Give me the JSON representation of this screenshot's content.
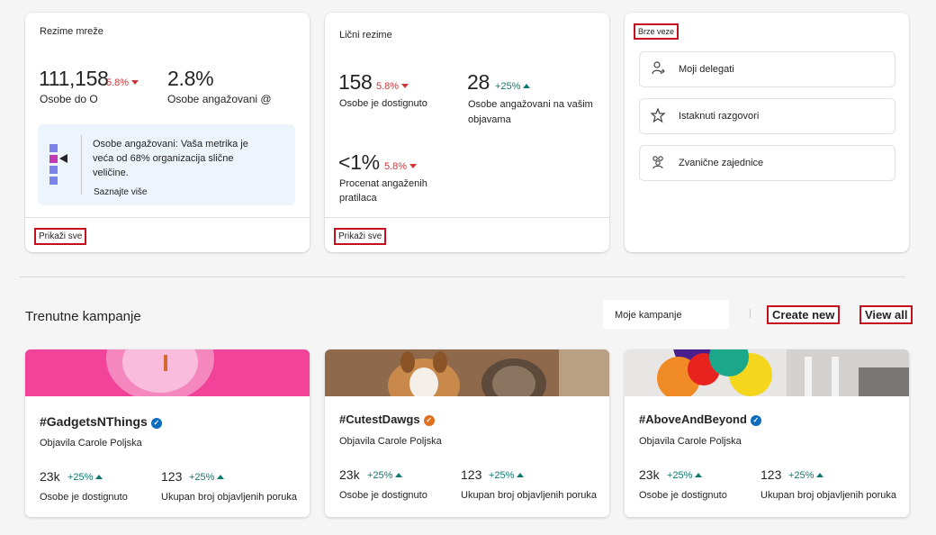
{
  "network": {
    "title": "Rezime mreže",
    "people_value": "111,158",
    "people_delta": "5.8%",
    "people_label": "Osobe do O",
    "engaged_value": "2.8%",
    "engaged_label": "Osobe angažovani @",
    "info_text": "Osobe angažovani: Vaša metrika je veća od 68% organizacija slične veličine.",
    "info_link": "Saznajte više",
    "show_all": "Prikaži sve"
  },
  "personal": {
    "title": "Lični rezime",
    "reached_value": "158",
    "reached_delta": "5.8%",
    "reached_label": "Osobe je dostignuto",
    "engaged_value": "28",
    "engaged_delta": "+25%",
    "engaged_label": "Osobe angažovani na vašim objavama",
    "followers_value": "<1%",
    "followers_delta": "5.8%",
    "followers_label": "Procenat angaženih pratilaca",
    "show_all": "Prikaži sve"
  },
  "quick_links": {
    "title": "Brze veze",
    "items": [
      {
        "label": "Moji delegati",
        "icon": "delegates-icon"
      },
      {
        "label": "Istaknuti razgovori",
        "icon": "star-icon"
      },
      {
        "label": "Zvanične zajednice",
        "icon": "community-icon"
      }
    ]
  },
  "campaigns": {
    "title": "Trenutne kampanje",
    "filter_value": "Moje kampanje",
    "create_new": "Create new",
    "view_all": "View all",
    "items": [
      {
        "name": "#GadgetsNThings",
        "verified_color": "#0f6cbd",
        "by": "Objavila Carole Poljska",
        "reached": "23k",
        "reached_delta": "+25%",
        "reached_label": "Osobe je dostignuto",
        "posts": "123",
        "posts_delta": "+25%",
        "posts_label": "Ukupan broj objavljenih poruka"
      },
      {
        "name": "#CutestDawgs",
        "verified_color": "#e0701f",
        "by": "Objavila Carole Poljska",
        "reached": "23k",
        "reached_delta": "+25%",
        "reached_label": "Osobe je dostignuto",
        "posts": "123",
        "posts_delta": "+25%",
        "posts_label": "Ukupan broj objavljenih poruka"
      },
      {
        "name": "#AboveAndBeyond",
        "verified_color": "#0f6cbd",
        "by": "Objavila Carole Poljska",
        "reached": "23k",
        "reached_delta": "+25%",
        "reached_label": "Osobe je dostignuto",
        "posts": "123",
        "posts_delta": "+25%",
        "posts_label": "Ukupan broj objavljenih poruka"
      }
    ]
  },
  "colors": {
    "highlight_border": "#c50f1f",
    "down": "#d13438",
    "up": "#0e7a6f",
    "brand": "#0f6cbd"
  }
}
